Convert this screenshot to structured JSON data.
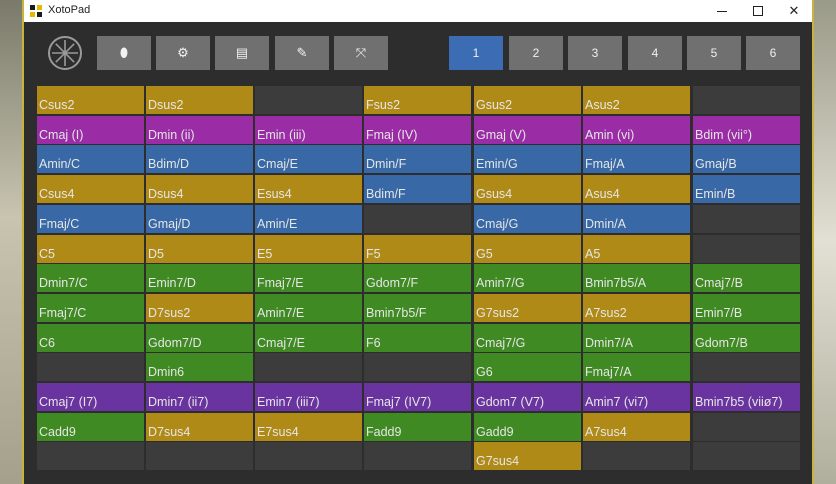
{
  "window": {
    "title": "XotoPad"
  },
  "toolbar": {
    "tools": [
      {
        "name": "ghost-icon",
        "symbol": "⬮"
      },
      {
        "name": "gear-icon",
        "symbol": "⚙"
      },
      {
        "name": "document-icon",
        "symbol": "▤"
      },
      {
        "name": "pencil-icon",
        "symbol": "✎"
      },
      {
        "name": "expand-icon",
        "symbol": "⤧"
      }
    ],
    "pages": [
      "1",
      "2",
      "3",
      "4",
      "5",
      "6"
    ],
    "active_page": "1"
  },
  "colors": {
    "gold": "#b08a17",
    "purple": "#9a2da6",
    "blue": "#3868a6",
    "green": "#3f8a22",
    "violet": "#6a34a0",
    "empty": "#3c3c3c"
  },
  "pads": [
    [
      [
        "Csus2",
        "gold"
      ],
      [
        "Dsus2",
        "gold"
      ],
      [
        "",
        "empty"
      ],
      [
        "Fsus2",
        "gold"
      ],
      [
        "Gsus2",
        "gold"
      ],
      [
        "Asus2",
        "gold"
      ],
      [
        "",
        "empty"
      ]
    ],
    [
      [
        "Cmaj (I)",
        "purple"
      ],
      [
        "Dmin (ii)",
        "purple"
      ],
      [
        "Emin (iii)",
        "purple"
      ],
      [
        "Fmaj (IV)",
        "purple"
      ],
      [
        "Gmaj (V)",
        "purple"
      ],
      [
        "Amin (vi)",
        "purple"
      ],
      [
        "Bdim (vii°)",
        "purple"
      ]
    ],
    [
      [
        "Amin/C",
        "blue"
      ],
      [
        "Bdim/D",
        "blue"
      ],
      [
        "Cmaj/E",
        "blue"
      ],
      [
        "Dmin/F",
        "blue"
      ],
      [
        "Emin/G",
        "blue"
      ],
      [
        "Fmaj/A",
        "blue"
      ],
      [
        "Gmaj/B",
        "blue"
      ]
    ],
    [
      [
        "Csus4",
        "gold"
      ],
      [
        "Dsus4",
        "gold"
      ],
      [
        "Esus4",
        "gold"
      ],
      [
        "Bdim/F",
        "blue"
      ],
      [
        "Gsus4",
        "gold"
      ],
      [
        "Asus4",
        "gold"
      ],
      [
        "Emin/B",
        "blue"
      ]
    ],
    [
      [
        "Fmaj/C",
        "blue"
      ],
      [
        "Gmaj/D",
        "blue"
      ],
      [
        "Amin/E",
        "blue"
      ],
      [
        "",
        "empty"
      ],
      [
        "Cmaj/G",
        "blue"
      ],
      [
        "Dmin/A",
        "blue"
      ],
      [
        "",
        "empty"
      ]
    ],
    [
      [
        "C5",
        "gold"
      ],
      [
        "D5",
        "gold"
      ],
      [
        "E5",
        "gold"
      ],
      [
        "F5",
        "gold"
      ],
      [
        "G5",
        "gold"
      ],
      [
        "A5",
        "gold"
      ],
      [
        "",
        "empty"
      ]
    ],
    [
      [
        "Dmin7/C",
        "green"
      ],
      [
        "Emin7/D",
        "green"
      ],
      [
        "Fmaj7/E",
        "green"
      ],
      [
        "Gdom7/F",
        "green"
      ],
      [
        "Amin7/G",
        "green"
      ],
      [
        "Bmin7b5/A",
        "green"
      ],
      [
        "Cmaj7/B",
        "green"
      ]
    ],
    [
      [
        "Fmaj7/C",
        "green"
      ],
      [
        "D7sus2",
        "gold"
      ],
      [
        "Amin7/E",
        "green"
      ],
      [
        "Bmin7b5/F",
        "green"
      ],
      [
        "G7sus2",
        "gold"
      ],
      [
        "A7sus2",
        "gold"
      ],
      [
        "Emin7/B",
        "green"
      ]
    ],
    [
      [
        "C6",
        "green"
      ],
      [
        "Gdom7/D",
        "green"
      ],
      [
        "Cmaj7/E",
        "green"
      ],
      [
        "F6",
        "green"
      ],
      [
        "Cmaj7/G",
        "green"
      ],
      [
        "Dmin7/A",
        "green"
      ],
      [
        "Gdom7/B",
        "green"
      ]
    ],
    [
      [
        "",
        "empty"
      ],
      [
        "Dmin6",
        "green"
      ],
      [
        "",
        "empty"
      ],
      [
        "",
        "empty"
      ],
      [
        "G6",
        "green"
      ],
      [
        "Fmaj7/A",
        "green"
      ],
      [
        "",
        "empty"
      ]
    ],
    [
      [
        "Cmaj7 (I7)",
        "violet"
      ],
      [
        "Dmin7 (ii7)",
        "violet"
      ],
      [
        "Emin7 (iii7)",
        "violet"
      ],
      [
        "Fmaj7 (IV7)",
        "violet"
      ],
      [
        "Gdom7 (V7)",
        "violet"
      ],
      [
        "Amin7 (vi7)",
        "violet"
      ],
      [
        "Bmin7b5 (viiø7)",
        "violet"
      ]
    ],
    [
      [
        "Cadd9",
        "green"
      ],
      [
        "D7sus4",
        "gold"
      ],
      [
        "E7sus4",
        "gold"
      ],
      [
        "Fadd9",
        "green"
      ],
      [
        "Gadd9",
        "green"
      ],
      [
        "A7sus4",
        "gold"
      ],
      [
        "",
        "empty"
      ]
    ],
    [
      [
        "",
        "empty"
      ],
      [
        "",
        "empty"
      ],
      [
        "",
        "empty"
      ],
      [
        "",
        "empty"
      ],
      [
        "G7sus4",
        "gold"
      ],
      [
        "",
        "empty"
      ],
      [
        "",
        "empty"
      ]
    ]
  ]
}
